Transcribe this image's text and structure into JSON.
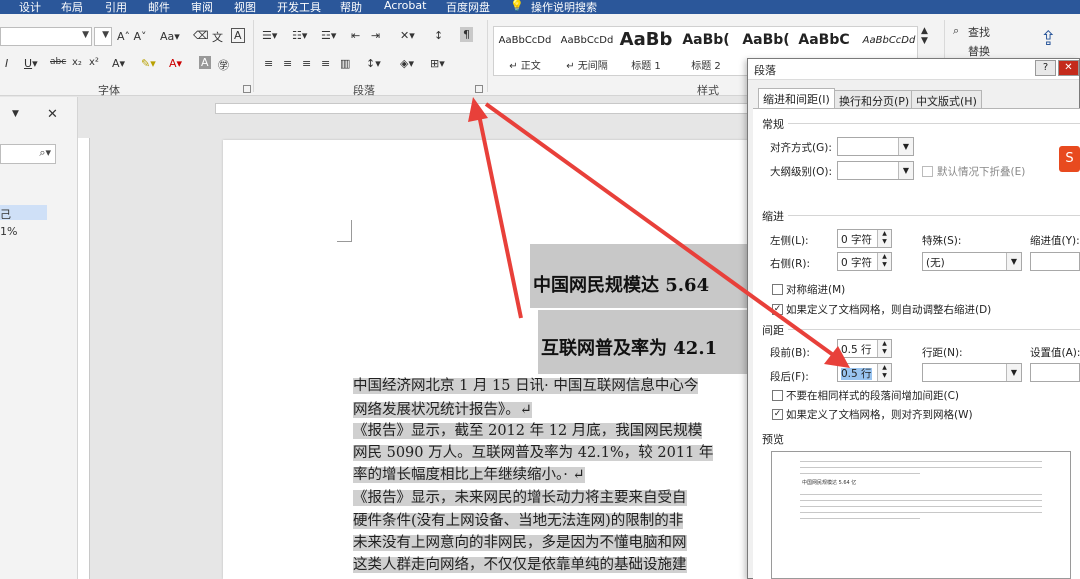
{
  "tabs": [
    "设计",
    "布局",
    "引用",
    "邮件",
    "审阅",
    "视图",
    "开发工具",
    "帮助",
    "Acrobat",
    "百度网盘",
    "操作说明搜索"
  ],
  "ribbon": {
    "font_group": "字体",
    "paragraph_group": "段落",
    "styles_group": "样式",
    "find": "查找",
    "replace": "替换",
    "styles": [
      {
        "preview": "AaBbCcDd",
        "name": "↵ 正文"
      },
      {
        "preview": "AaBbCcDd",
        "name": "↵ 无间隔"
      },
      {
        "preview": "AaBb",
        "name": "标题 1"
      },
      {
        "preview": "AaBb(",
        "name": "标题 2"
      },
      {
        "preview": "AaBb(",
        "name": ""
      },
      {
        "preview": "AaBbC",
        "name": ""
      },
      {
        "preview": "AaBbCcDd",
        "name": ""
      }
    ]
  },
  "nav": {
    "percent": "1%",
    "char": "己"
  },
  "document": {
    "title1": "中国网民规模达 5.64",
    "title2": "互联网普及率为 42.1",
    "lines": [
      "中国经济网北京 1 月 15 日讯· 中国互联网信息中心今",
      "网络发展状况统计报告》。↵",
      "《报告》显示，截至 2012 年 12 月底，我国网民规模",
      "网民 5090 万人。互联网普及率为 42.1%，较 2011 年",
      "率的增长幅度相比上年继续缩小。· ↵",
      "《报告》显示，未来网民的增长动力将主要来自受自",
      "硬件条件(没有上网设备、当地无法连网)的限制的非",
      "未来没有上网意向的非网民，多是因为不懂电脑和网",
      "这类人群走向网络，不仅仅是依靠单纯的基础设施建"
    ]
  },
  "dialog": {
    "title": "段落",
    "help": "?",
    "tabs": [
      "缩进和间距(I)",
      "换行和分页(P)",
      "中文版式(H)"
    ],
    "general": "常规",
    "alignment_label": "对齐方式(G):",
    "outline_label": "大纲级别(O):",
    "collapse_label": "默认情况下折叠(E)",
    "indent_section": "缩进",
    "left_label": "左侧(L):",
    "left_value": "0 字符",
    "right_label": "右侧(R):",
    "right_value": "0 字符",
    "special_label": "特殊(S):",
    "special_value": "(无)",
    "indent_value_label": "缩进值(Y):",
    "mirror_label": "对称缩进(M)",
    "auto_adjust_label": "如果定义了文档网格，则自动调整右缩进(D)",
    "spacing_section": "间距",
    "before_label": "段前(B):",
    "before_value": "0.5 行",
    "after_label": "段后(F):",
    "after_value": "0.5 行",
    "line_spacing_label": "行距(N):",
    "setting_label": "设置值(A):",
    "no_space_label": "不要在相同样式的段落间增加间距(C)",
    "snap_grid_label": "如果定义了文档网格，则对齐到网格(W)",
    "preview_section": "预览",
    "preview_text": "中国网民规模达 5.64 亿"
  },
  "colors": {
    "tabbar": "#2b579a",
    "arrow": "#e8403a",
    "selection": "#c8c8c8"
  }
}
